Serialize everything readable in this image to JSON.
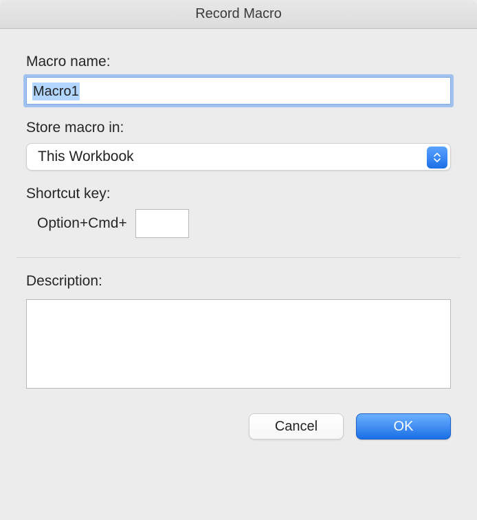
{
  "dialog": {
    "title": "Record Macro"
  },
  "labels": {
    "macro_name": "Macro name:",
    "store_in": "Store macro in:",
    "shortcut_key": "Shortcut key:",
    "shortcut_prefix": "Option+Cmd+",
    "description": "Description:"
  },
  "fields": {
    "macro_name_value": "Macro1",
    "store_in_value": "This Workbook",
    "shortcut_value": "",
    "description_value": ""
  },
  "buttons": {
    "cancel": "Cancel",
    "ok": "OK"
  }
}
